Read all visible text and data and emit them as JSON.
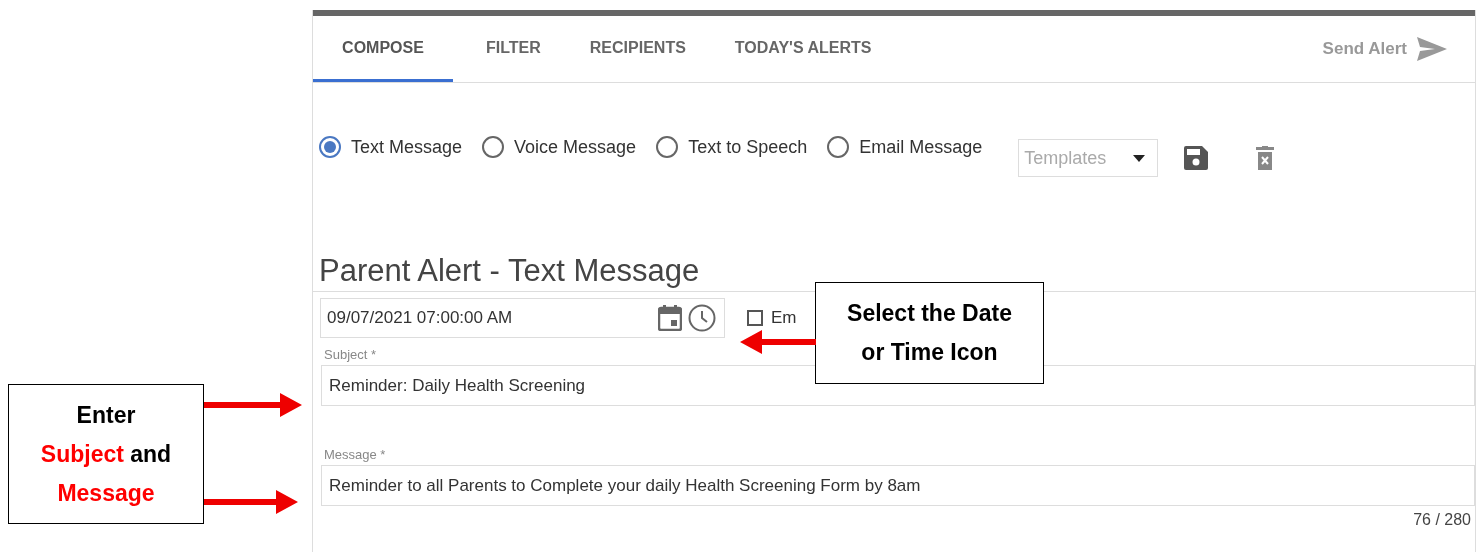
{
  "tabs": [
    {
      "label": "COMPOSE",
      "selected": true
    },
    {
      "label": "FILTER",
      "selected": false
    },
    {
      "label": "RECIPIENTS",
      "selected": false
    },
    {
      "label": "TODAY'S ALERTS",
      "selected": false
    }
  ],
  "send_button": {
    "label": "Send Alert",
    "disabled": true
  },
  "message_types": [
    {
      "label": "Text Message",
      "selected": true
    },
    {
      "label": "Voice Message",
      "selected": false
    },
    {
      "label": "Text to Speech",
      "selected": false
    },
    {
      "label": "Email Message",
      "selected": false
    }
  ],
  "templates": {
    "placeholder": "Templates"
  },
  "heading": "Parent Alert - Text Message",
  "schedule": {
    "value": "09/07/2021 07:00:00 AM"
  },
  "email_option": {
    "label": "Em",
    "checked": false
  },
  "subject": {
    "label": "Subject *",
    "value": "Reminder:  Daily Health Screening"
  },
  "message": {
    "label": "Message *",
    "value": "Reminder to all Parents to Complete your daily Health Screening Form by 8am",
    "counter": "76 / 280"
  },
  "callouts": [
    {
      "parts": [
        {
          "text": "Select the Date",
          "highlight": false
        },
        {
          "text": "or Time Icon",
          "highlight": false
        }
      ]
    },
    {
      "parts": [
        {
          "text": "Enter",
          "highlight": false
        },
        {
          "text": "Subject",
          "highlight": true
        },
        {
          "text": "and",
          "highlight": false
        },
        {
          "text": "Message",
          "highlight": true
        }
      ]
    }
  ]
}
